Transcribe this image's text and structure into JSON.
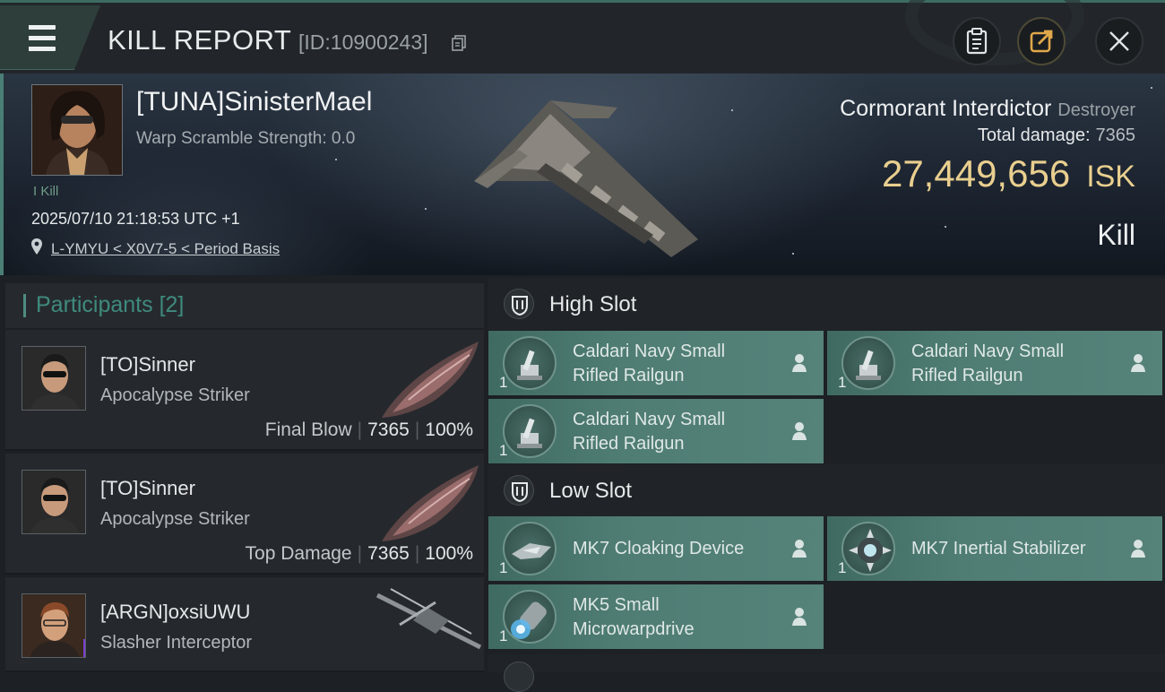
{
  "header": {
    "title": "KILL REPORT",
    "report_id": "[ID:10900243]"
  },
  "victim": {
    "name": "[TUNA]SinisterMael",
    "warp_scramble": "Warp Scramble Strength: 0.0",
    "kill_tag": "I Kill",
    "datetime": "2025/07/10 21:18:53 UTC +1",
    "location": "L-YMYU < X0V7-5 < Period Basis",
    "ship": "Cormorant Interdictor",
    "ship_class": "Destroyer",
    "total_damage_label": "Total damage:",
    "total_damage": "7365",
    "isk_value": "27,449,656",
    "isk_unit": "ISK",
    "result": "Kill"
  },
  "participants": {
    "label": "Participants",
    "count": "[2]",
    "rows": [
      {
        "name": "[TO]Sinner",
        "ship": "Apocalypse Striker",
        "role": "Final Blow",
        "damage": "7365",
        "percent": "100%"
      },
      {
        "name": "[TO]Sinner",
        "ship": "Apocalypse Striker",
        "role": "Top Damage",
        "damage": "7365",
        "percent": "100%"
      },
      {
        "name": "[ARGN]oxsiUWU",
        "ship": "Slasher Interceptor",
        "badge": "i"
      }
    ]
  },
  "slots": {
    "high": {
      "label": "High Slot",
      "modules": [
        {
          "line1": "Caldari Navy Small",
          "line2": "Rifled Railgun",
          "qty": "1",
          "icon": "railgun-icon"
        },
        {
          "line1": "Caldari Navy Small",
          "line2": "Rifled Railgun",
          "qty": "1",
          "icon": "railgun-icon"
        },
        {
          "line1": "Caldari Navy Small",
          "line2": "Rifled Railgun",
          "qty": "1",
          "icon": "railgun-icon"
        }
      ]
    },
    "low": {
      "label": "Low Slot",
      "modules": [
        {
          "line1": "MK7 Cloaking Device",
          "qty": "1",
          "icon": "cloaking-device-icon"
        },
        {
          "line1": "MK7 Inertial Stabilizer",
          "qty": "1",
          "icon": "inertial-stabilizer-icon"
        },
        {
          "line1": "MK5 Small",
          "line2": "Microwarpdrive",
          "qty": "1",
          "icon": "microwarpdrive-icon"
        }
      ]
    }
  },
  "colors": {
    "accent": "#4a7f76",
    "isk": "#e9cf8f",
    "module_bg": "#4f7d74"
  }
}
